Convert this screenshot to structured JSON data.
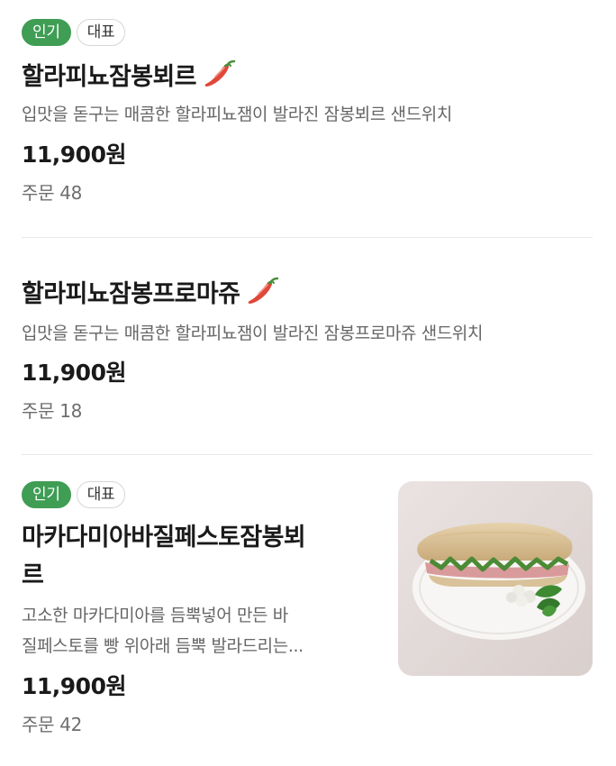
{
  "items": [
    {
      "badges": [
        "인기",
        "대표"
      ],
      "name": "할라피뇨잠봉뵈르",
      "description": "입맛을 돋구는 매콤한 할라피뇨잼이 발라진 잠봉뵈르 샌드위치",
      "price": "11,900원",
      "orders": "주문 48",
      "spicy_icon": "chili-pepper-icon"
    },
    {
      "name": "할라피뇨잠봉프로마쥬",
      "description": "입맛을 돋구는 매콤한 할라피뇨잼이 발라진 잠봉프로마쥬 샌드위치",
      "price": "11,900원",
      "orders": "주문 18",
      "spicy_icon": "chili-pepper-icon"
    },
    {
      "badges": [
        "인기",
        "대표"
      ],
      "name_lines": [
        "마카다미아바질페스토잠봉뵈",
        "르"
      ],
      "description_lines": [
        "고소한 마카다미아를 듬뿍넣어 만든 바",
        "질페스토를 빵 위아래 듬뿍 발라드리는..."
      ],
      "price": "11,900원",
      "orders": "주문 42",
      "image": "sandwich-photo"
    }
  ],
  "colors": {
    "popular_badge": "#3f9d54",
    "pepper": "#e0483a",
    "text_primary": "#1a1a1a",
    "text_secondary": "#666666"
  }
}
